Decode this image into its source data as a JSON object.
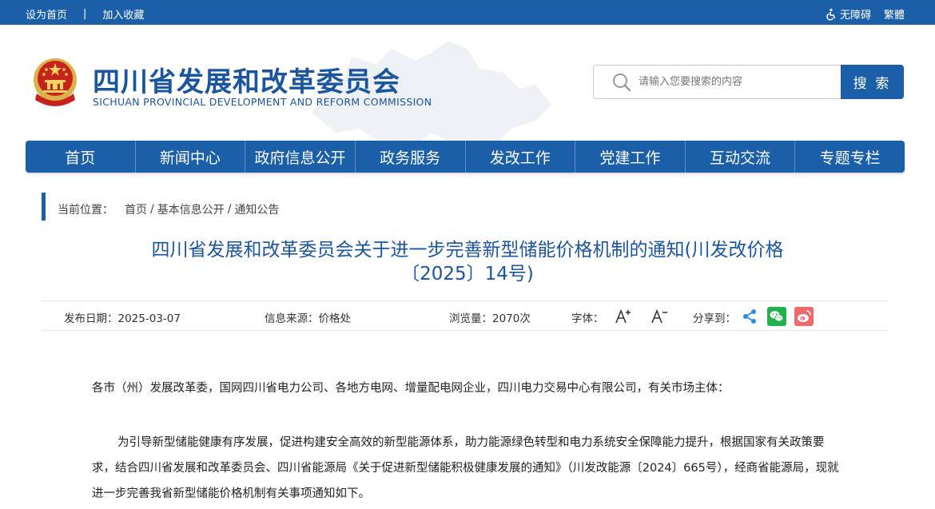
{
  "topbar": {
    "set_home": "设为首页",
    "separator": "|",
    "add_favorite": "加入收藏",
    "accessibility": "无障碍",
    "traditional": "繁體"
  },
  "header": {
    "title": "四川省发展和改革委员会",
    "subtitle": "SICHUAN PROVINCIAL DEVELOPMENT AND REFORM COMMISSION"
  },
  "search": {
    "placeholder": "请输入您要搜索的内容",
    "button_label": "搜 索"
  },
  "nav": {
    "items": [
      {
        "label": "首页"
      },
      {
        "label": "新闻中心"
      },
      {
        "label": "政府信息公开"
      },
      {
        "label": "政务服务"
      },
      {
        "label": "发改工作"
      },
      {
        "label": "党建工作"
      },
      {
        "label": "互动交流"
      },
      {
        "label": "专题专栏"
      }
    ]
  },
  "breadcrumb": {
    "label": "当前位置：",
    "items": [
      "首页",
      "基本信息公开",
      "通知公告"
    ],
    "separator": "/"
  },
  "article": {
    "title_line1": "四川省发展和改革委员会关于进一步完善新型储能价格机制的通知(川发改价格",
    "title_line2": "〔2025〕14号)",
    "meta": {
      "date": "发布日期：2025-03-07",
      "source": "信息来源：价格处",
      "views": "浏览量：2070次",
      "font_label": "字体：",
      "share_label": "分享到："
    },
    "paragraphs": [
      "各市（州）发展改革委，国网四川省电力公司、各地方电网、增量配电网企业，四川电力交易中心有限公司，有关市场主体：",
      "为引导新型储能健康有序发展，促进构建安全高效的新型能源体系，助力能源绿色转型和电力系统安全保障能力提升，根据国家有关政策要求，结合四川省发展和改革委员会、四川省能源局《关于促进新型储能积极健康发展的通知》（川发改能源〔2024〕665号），经商省能源局，现就进一步完善我省新型储能价格机制有关事项通知如下。"
    ]
  },
  "colors": {
    "brand_blue": "#1a5fa8",
    "title_blue": "#1a56a0",
    "wechat_green": "#22b14c",
    "weibo_red": "#f06a6a",
    "share_blue": "#2b8ee6"
  },
  "icons": [
    "accessibility-icon",
    "search-icon",
    "font-increase-icon",
    "font-decrease-icon",
    "share-icon",
    "wechat-icon",
    "weibo-icon",
    "national-emblem-icon"
  ]
}
